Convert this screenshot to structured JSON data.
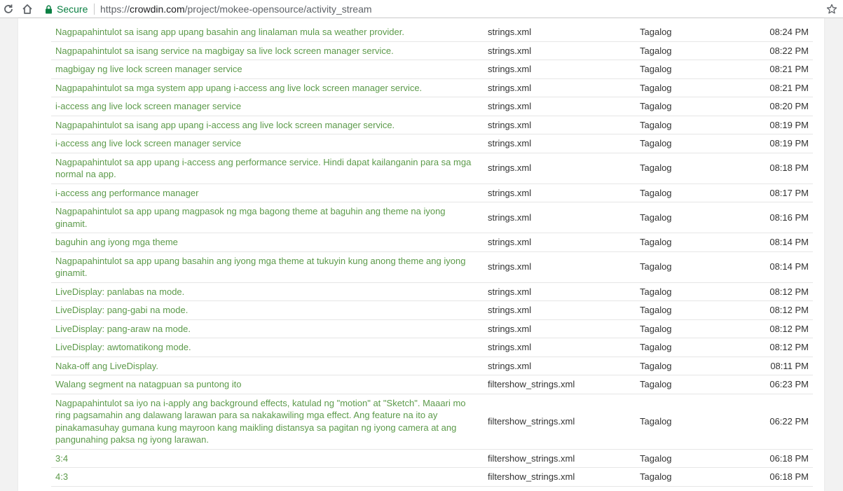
{
  "browser": {
    "secure_label": "Secure",
    "url_scheme": "https://",
    "url_host": "crowdin.com",
    "url_path": "/project/mokee-opensource/activity_stream",
    "icons": {
      "reload": "reload-icon",
      "home": "home-icon",
      "lock": "lock-icon",
      "bookmark": "star-icon"
    },
    "colors": {
      "secure": "#0b8043"
    }
  },
  "activity": {
    "colors": {
      "link": "#5c9a4a"
    },
    "rows": [
      {
        "text": "Nagpapahintulot sa isang app upang basahin ang linalaman mula sa weather provider.",
        "file": "strings.xml",
        "language": "Tagalog",
        "time": "08:24 PM"
      },
      {
        "text": "Nagpapahintulot sa isang service na magbigay sa live lock screen manager service.",
        "file": "strings.xml",
        "language": "Tagalog",
        "time": "08:22 PM"
      },
      {
        "text": "magbigay ng live lock screen manager service",
        "file": "strings.xml",
        "language": "Tagalog",
        "time": "08:21 PM"
      },
      {
        "text": "Nagpapahintulot sa mga system app upang i-access ang live lock screen manager service.",
        "file": "strings.xml",
        "language": "Tagalog",
        "time": "08:21 PM"
      },
      {
        "text": "i-access ang live lock screen manager service",
        "file": "strings.xml",
        "language": "Tagalog",
        "time": "08:20 PM"
      },
      {
        "text": "Nagpapahintulot sa isang app upang i-access ang live lock screen manager service.",
        "file": "strings.xml",
        "language": "Tagalog",
        "time": "08:19 PM"
      },
      {
        "text": "i-access ang live lock screen manager service",
        "file": "strings.xml",
        "language": "Tagalog",
        "time": "08:19 PM"
      },
      {
        "text": "Nagpapahintulot sa app upang i-access ang performance service. Hindi dapat kailanganin para sa mga normal na app.",
        "file": "strings.xml",
        "language": "Tagalog",
        "time": "08:18 PM"
      },
      {
        "text": "i-access ang performance manager",
        "file": "strings.xml",
        "language": "Tagalog",
        "time": "08:17 PM"
      },
      {
        "text": "Nagpapahintulot sa app upang magpasok ng mga bagong theme at baguhin ang theme na iyong ginamit.",
        "file": "strings.xml",
        "language": "Tagalog",
        "time": "08:16 PM"
      },
      {
        "text": "baguhin ang iyong mga theme",
        "file": "strings.xml",
        "language": "Tagalog",
        "time": "08:14 PM"
      },
      {
        "text": "Nagpapahintulot sa app upang basahin ang iyong mga theme at tukuyin kung anong theme ang iyong ginamit.",
        "file": "strings.xml",
        "language": "Tagalog",
        "time": "08:14 PM"
      },
      {
        "text": "LiveDisplay: panlabas na mode.",
        "file": "strings.xml",
        "language": "Tagalog",
        "time": "08:12 PM"
      },
      {
        "text": "LiveDisplay: pang-gabi na mode.",
        "file": "strings.xml",
        "language": "Tagalog",
        "time": "08:12 PM"
      },
      {
        "text": "LiveDisplay: pang-araw na mode.",
        "file": "strings.xml",
        "language": "Tagalog",
        "time": "08:12 PM"
      },
      {
        "text": "LiveDisplay: awtomatikong mode.",
        "file": "strings.xml",
        "language": "Tagalog",
        "time": "08:12 PM"
      },
      {
        "text": "Naka-off ang LiveDisplay.",
        "file": "strings.xml",
        "language": "Tagalog",
        "time": "08:11 PM"
      },
      {
        "text": "Walang segment na natagpuan sa puntong ito",
        "file": "filtershow_strings.xml",
        "language": "Tagalog",
        "time": "06:23 PM"
      },
      {
        "text": "Nagpapahintulot sa iyo na i-apply ang background effects, katulad ng \"motion\" at \"Sketch\". Maaari mo ring pagsamahin ang dalawang larawan para sa nakakawiling mga effect. Ang feature na ito ay pinakamasuhay gumana kung mayroon kang maikling distansya sa pagitan ng iyong camera at ang pangunahing paksa ng iyong larawan.",
        "file": "filtershow_strings.xml",
        "language": "Tagalog",
        "time": "06:22 PM"
      },
      {
        "text": "3:4",
        "file": "filtershow_strings.xml",
        "language": "Tagalog",
        "time": "06:18 PM"
      },
      {
        "text": "4:3",
        "file": "filtershow_strings.xml",
        "language": "Tagalog",
        "time": "06:18 PM"
      }
    ]
  }
}
